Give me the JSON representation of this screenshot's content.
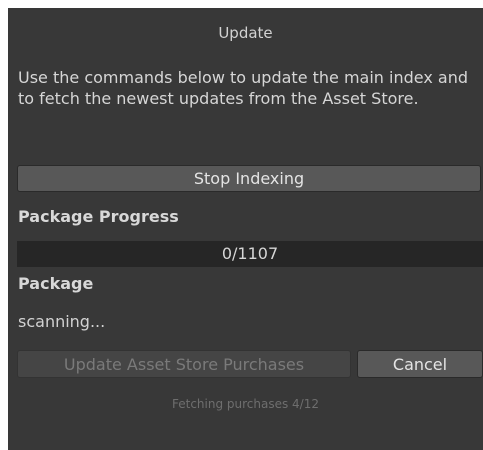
{
  "panel": {
    "title": "Update",
    "description": "Use the commands below to update the main index and to fetch the newest updates from the Asset Store.",
    "stop_indexing_label": "Stop Indexing",
    "package_progress_label": "Package Progress",
    "progress": {
      "text": "0/1107",
      "current": 0,
      "total": 1107
    },
    "package_label": "Package",
    "package_status": "scanning...",
    "update_purchases_label": "Update Asset Store Purchases",
    "cancel_label": "Cancel",
    "footer_status": "Fetching purchases 4/12"
  }
}
